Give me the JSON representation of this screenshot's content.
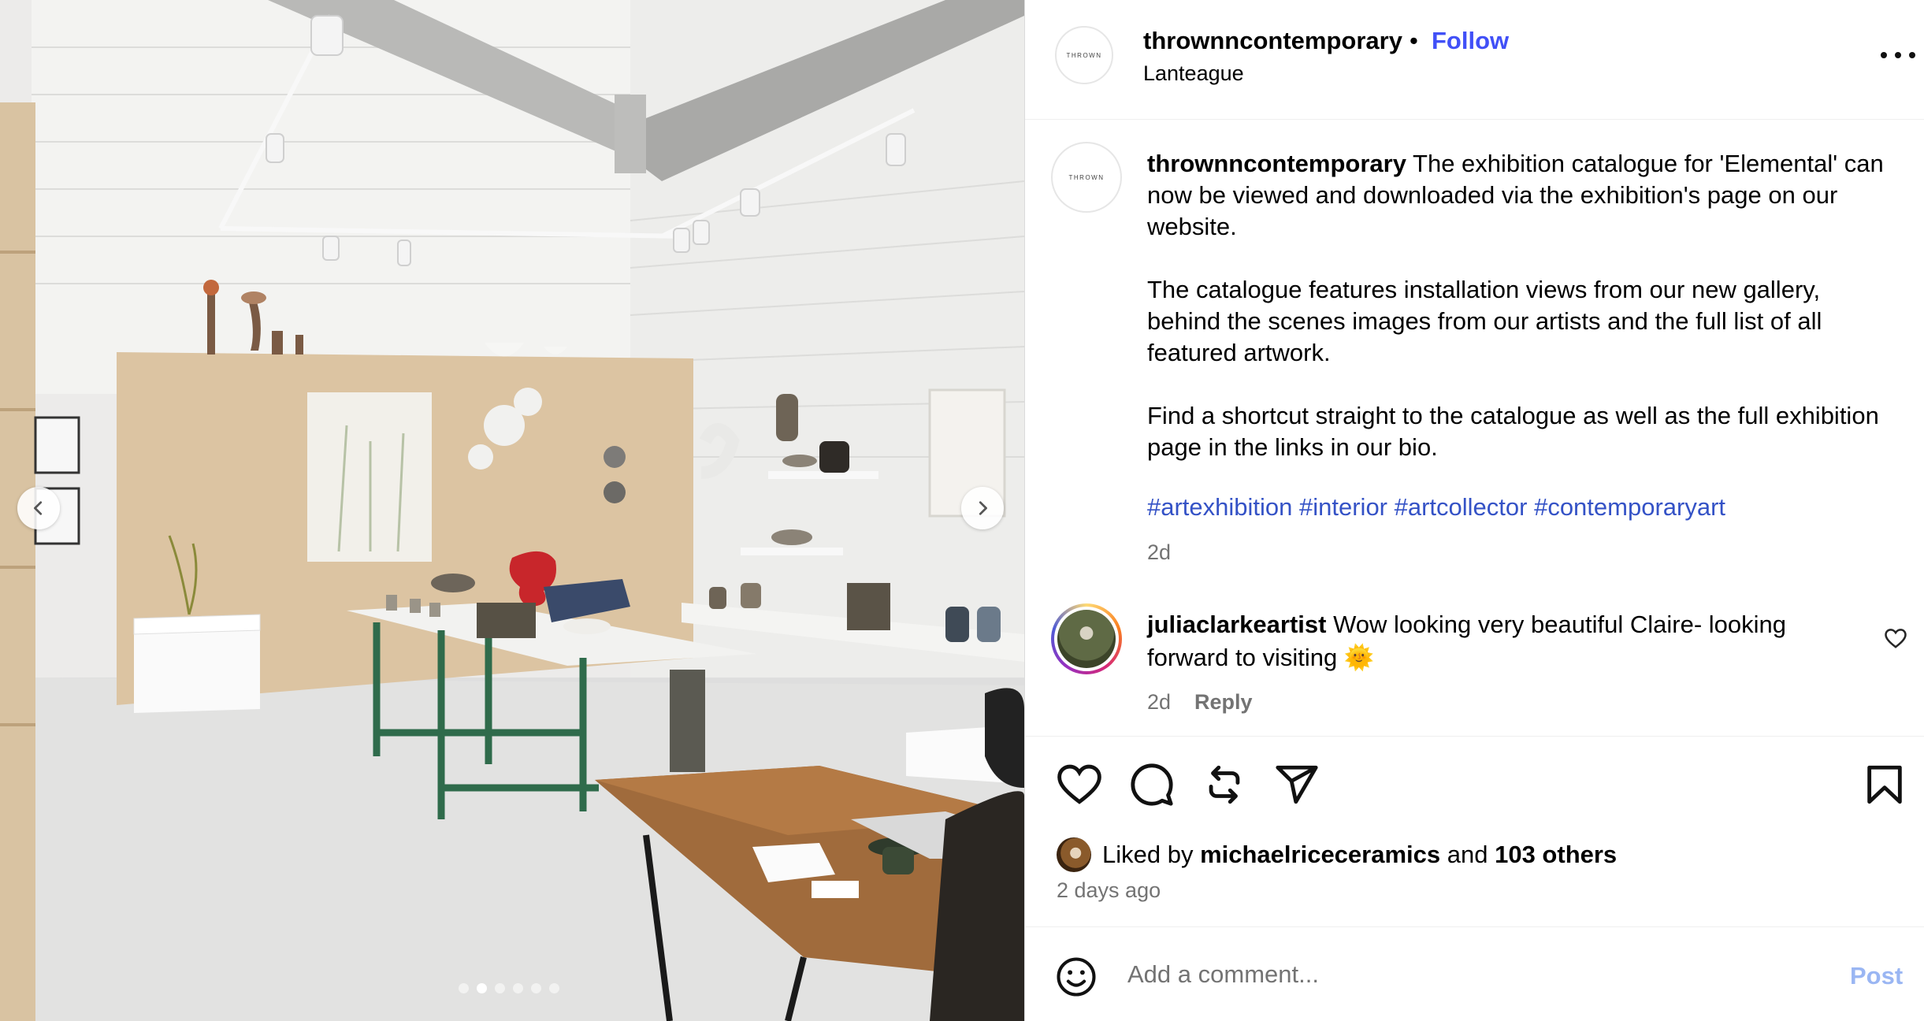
{
  "media": {
    "dots_count": 6,
    "active_dot_index": 1
  },
  "header": {
    "username": "thrownncontemporary",
    "separator": "•",
    "follow_label": "Follow",
    "location": "Lanteague",
    "avatar_text": "THROWN"
  },
  "caption": {
    "avatar_text": "THROWN",
    "username": "thrownncontemporary",
    "text": " The exhibition catalogue for 'Elemental' can now be viewed and downloaded via the exhibition's page on our website.\n\nThe catalogue features installation views from our new gallery, behind the scenes images from our artists and the full list of all featured artwork.\n\nFind a shortcut straight to the catalogue as well as the full exhibition page in the links in our bio.",
    "hashtags": "#artexhibition #interior #artcollector #contemporaryart",
    "age": "2d"
  },
  "comment": {
    "username": "juliaclarkeartist",
    "text": " Wow looking very beautiful Claire- looking forward to visiting 🌞",
    "age": "2d",
    "reply_label": "Reply",
    "like_icon": "heart-outline-icon"
  },
  "actions": {
    "icons": [
      "heart-icon",
      "comment-icon",
      "repost-icon",
      "share-icon",
      "bookmark-icon"
    ],
    "liked_prefix": "Liked by ",
    "liked_user": "michaelriceceramics",
    "liked_mid": " and ",
    "liked_others": "103 others",
    "posted": "2 days ago"
  },
  "add_comment": {
    "placeholder": "Add a comment...",
    "post_label": "Post"
  },
  "colors": {
    "link_blue": "#4150f7",
    "hashtag_blue": "#3452c6",
    "muted_text": "#737373",
    "post_button_disabled": "#9ab6f3"
  }
}
